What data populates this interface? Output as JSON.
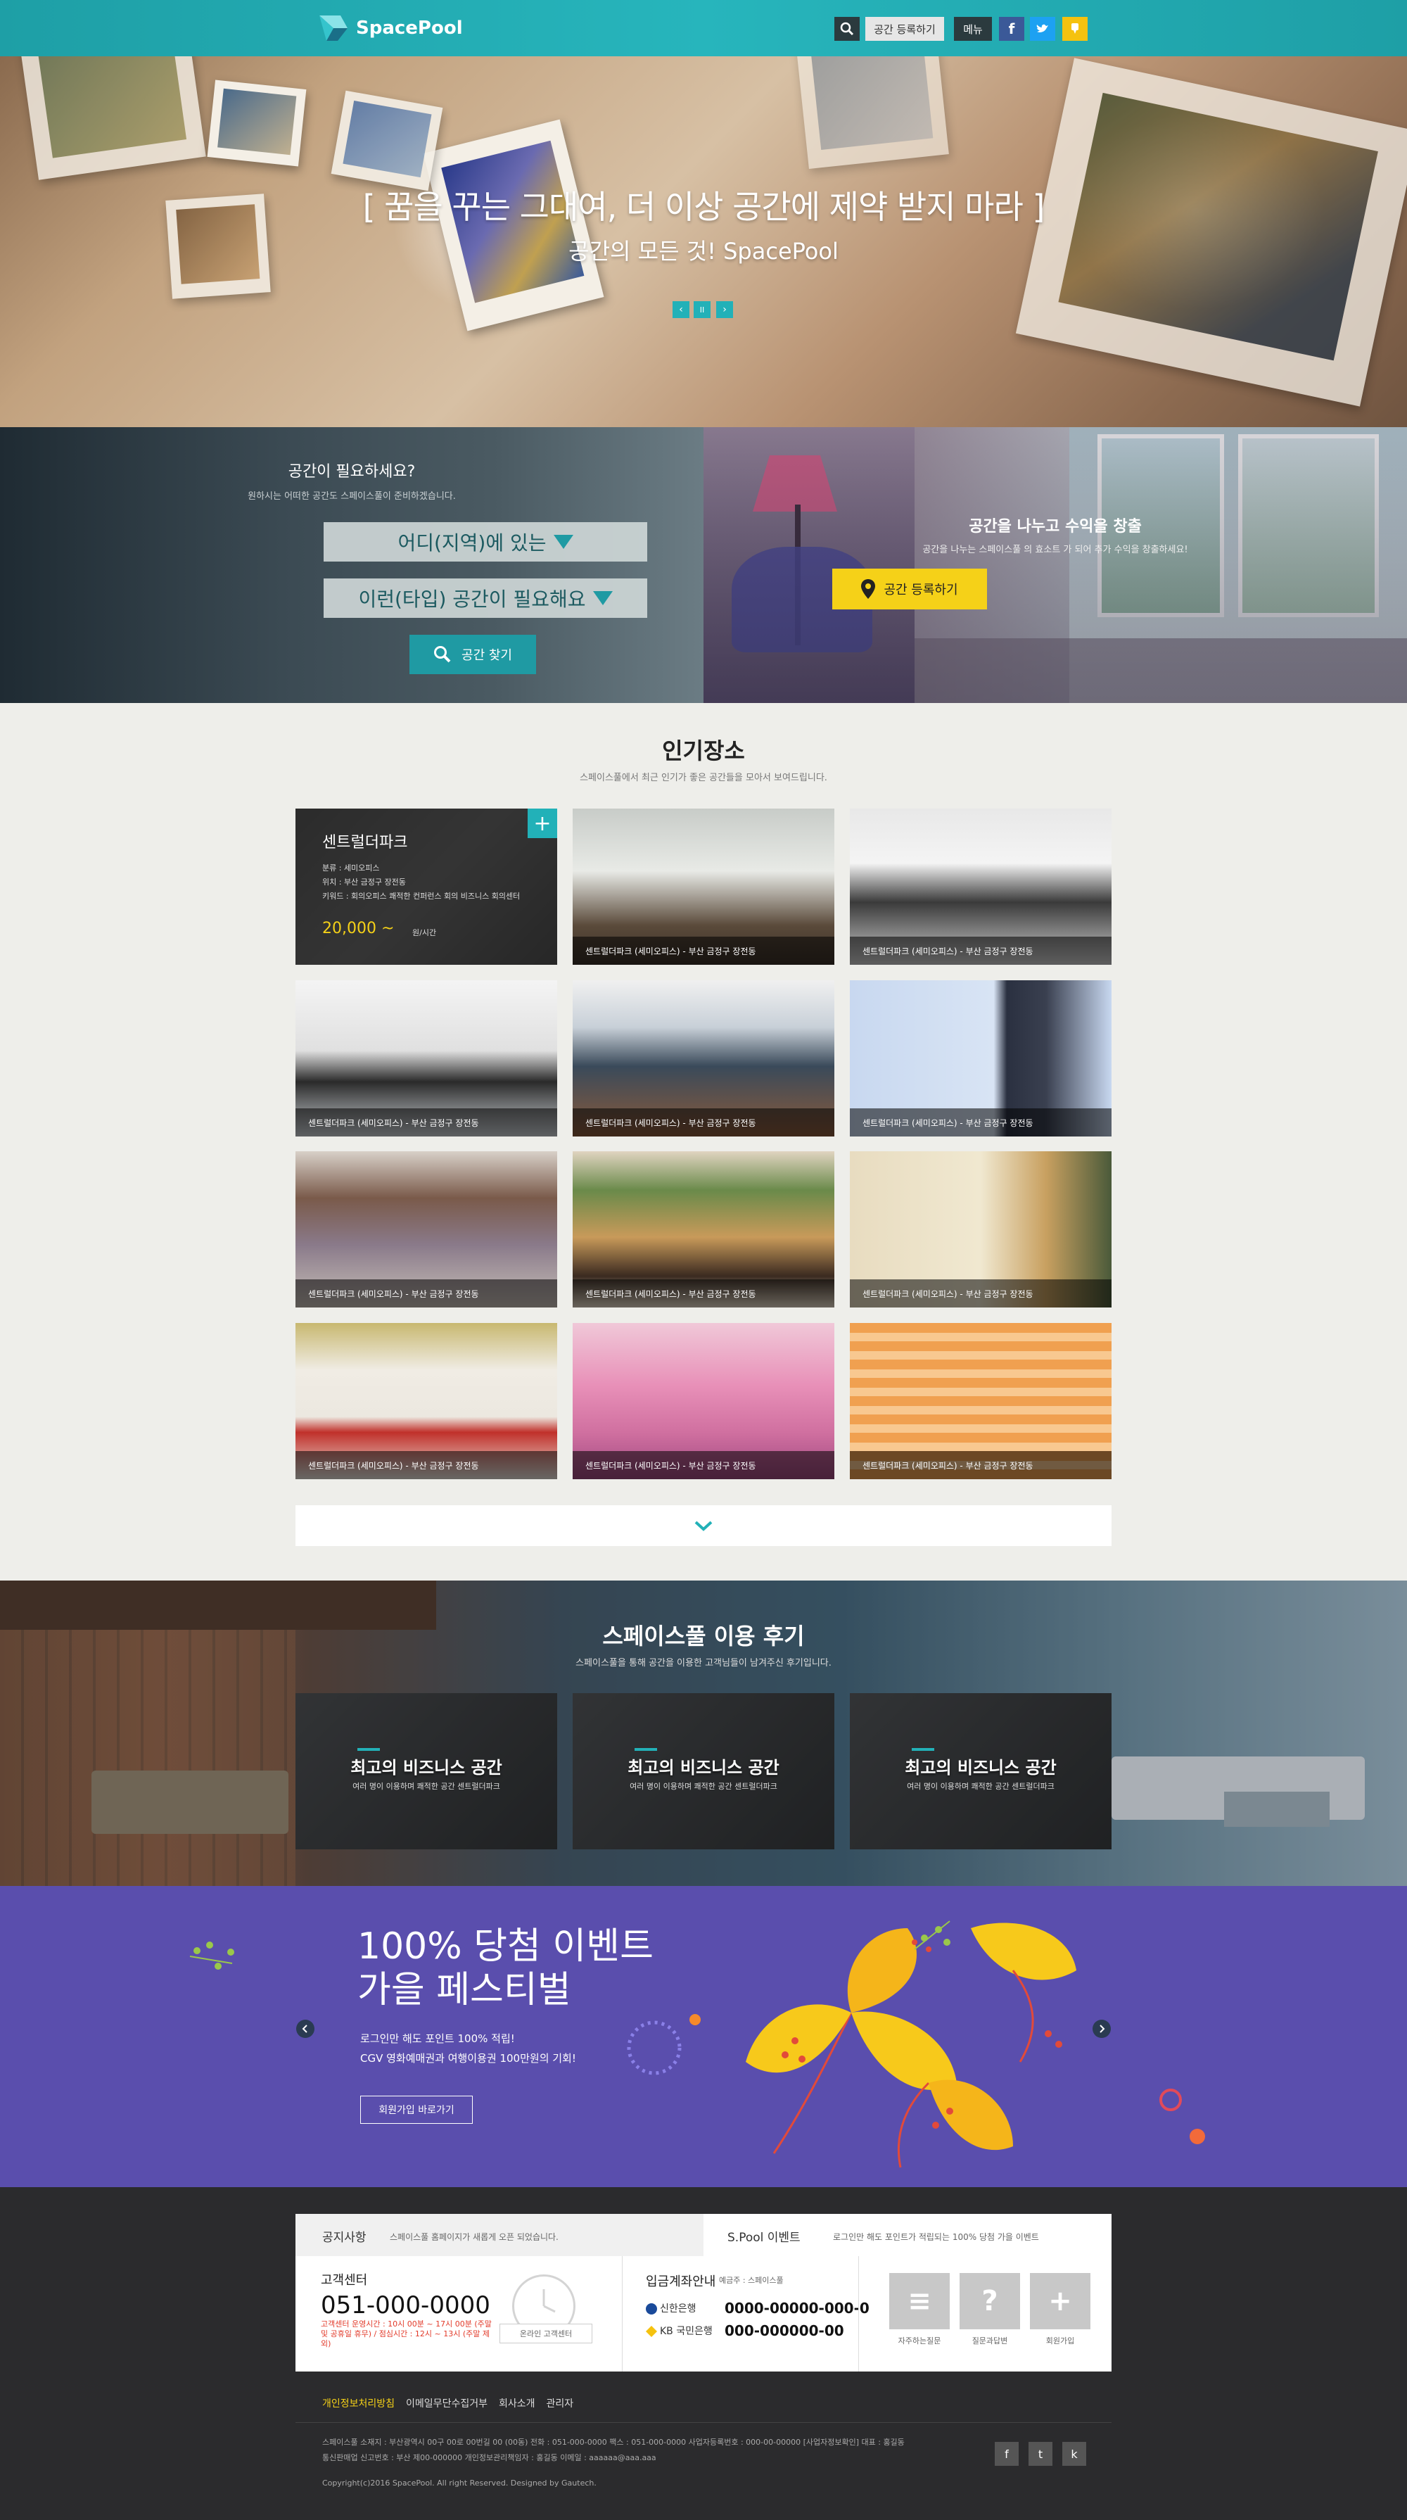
{
  "header": {
    "logo": "SpacePool",
    "register_label": "공간 등록하기",
    "menu_label": "메뉴",
    "facebook": "f",
    "colors": {
      "accent": "#22b1b8",
      "header": "#27b5bc"
    }
  },
  "hero": {
    "title": "[ 꿈을 꾸는 그대여, 더 이상 공간에 제약 받지 마라 ]",
    "subtitle": "공간의 모든 것! SpacePool",
    "prev": "‹",
    "pause": "II",
    "next": "›"
  },
  "find": {
    "title": "공간이 필요하세요?",
    "desc": "원하시는 어떠한 공간도 스페이스풀이 준비하겠습니다.",
    "region_select": "어디(지역)에 있는",
    "type_select": "이런(타입) 공간이 필요해요",
    "button": "공간 찾기"
  },
  "share": {
    "title": "공간을 나누고 수익을 창출",
    "desc": "공간을 나누는 스페이스풀 의 효소트 가 되어 추가 수익을 창출하세요!",
    "button": "공간 등록하기"
  },
  "popular": {
    "title": "인기장소",
    "desc": "스페이스풀에서 최근 인기가 좋은 공간들을 모아서 보여드립니다.",
    "featured": {
      "name": "센트럴더파크",
      "line1": "분류 : 세미오피스",
      "line2": "위치 : 부산 금정구 장전동",
      "line3": "키워드 : 회의오피스 쾌적한 컨퍼런스 회의 비즈니스 회의센터",
      "price": "20,000 ~",
      "unit": "원/시간",
      "plus": "+"
    },
    "captions": [
      "센트럴더파크 (세미오피스) - 부산 금정구 장전동",
      "센트럴더파크 (세미오피스) - 부산 금정구 장전동",
      "센트럴더파크 (세미오피스) - 부산 금정구 장전동",
      "센트럴더파크 (세미오피스) - 부산 금정구 장전동",
      "센트럴더파크 (세미오피스) - 부산 금정구 장전동",
      "센트럴더파크 (세미오피스) - 부산 금정구 장전동",
      "센트럴더파크 (세미오피스) - 부산 금정구 장전동",
      "센트럴더파크 (세미오피스) - 부산 금정구 장전동",
      "센트럴더파크 (세미오피스) - 부산 금정구 장전동",
      "센트럴더파크 (세미오피스) - 부산 금정구 장전동",
      "센트럴더파크 (세미오피스) - 부산 금정구 장전동"
    ]
  },
  "review": {
    "title": "스페이스풀 이용 후기",
    "desc": "스페이스풀을 통해 공간을 이용한 고객님들이 남겨주신 후기입니다.",
    "cards": [
      {
        "title": "최고의 비즈니스 공간",
        "sub": "여러 명이 이용하며 쾌적한 공간 센트럴더파크"
      },
      {
        "title": "최고의 비즈니스 공간",
        "sub": "여러 명이 이용하며 쾌적한 공간 센트럴더파크"
      },
      {
        "title": "최고의 비즈니스 공간",
        "sub": "여러 명이 이용하며 쾌적한 공간 센트럴더파크"
      }
    ]
  },
  "event": {
    "title1": "100% 당첨 이벤트",
    "title2": "가을 페스티벌",
    "line1": "로그인만 해도 포인트 100% 적립!",
    "line2": "CGV 영화예매권과 여행이용권 100만원의 기회!",
    "button": "회원가입 바로가기",
    "colors": {
      "bg": "#5a4ead",
      "leaf": "#f7c91b"
    }
  },
  "footer": {
    "notice_label": "공지사항",
    "notice_text": "스페이스풀 홈페이지가 새롭게 오픈 되었습니다.",
    "event_label": "S.Pool 이벤트",
    "event_text": "로그인만 해도 포인트가 적립되는 100% 당첨 가을 이벤트",
    "cs_title": "고객센터",
    "cs_tel": "051-000-0000",
    "cs_hours": "고객센터 운영시간 : 10시 00분 ~ 17시 00분 (주말 및 공휴일 휴무) / 점심시간 : 12시 ~ 13시 (주말 제외)",
    "cs_note": "",
    "online_btn": "온라인 고객센터",
    "bank_title": "입금계좌안내",
    "bank_holder": "예금주 : 스페이스풀",
    "bank1_name": "신한은행",
    "bank1_acct": "0000-00000-000-0",
    "bank2_name": "KB 국민은행",
    "bank2_acct": "000-000000-00",
    "quick": [
      {
        "icon": "≡",
        "label": "자주하는질문"
      },
      {
        "icon": "?",
        "label": "질문과답변"
      },
      {
        "icon": "+",
        "label": "회원가입"
      }
    ],
    "links": [
      "개인정보처리방침",
      "이메일무단수집거부",
      "회사소개",
      "관리자"
    ],
    "info1": "스페이스풀   소재지 : 부산광역시 00구 00로 00번길 00 (00동)   전화 : 051-000-0000   팩스 : 051-000-0000   사업자등록번호 : 000-00-00000   [사업자정보확인]   대표 : 홍길동",
    "info2": "통신판매업 신고번호 : 부산 제00-000000   개인정보관리책임자 : 홍길동   이메일 : aaaaaa@aaa.aaa",
    "copyright": "Copyright(c)2016 SpacePool. All right Reserved. Designed by Gautech.",
    "sns": [
      "f",
      "t",
      "k"
    ]
  }
}
